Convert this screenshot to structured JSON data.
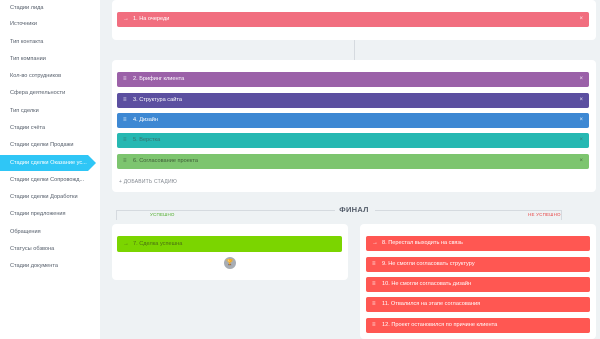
{
  "sidebar": {
    "items": [
      {
        "label": "Стадии лида"
      },
      {
        "label": "Источники"
      },
      {
        "label": "Тип контакта"
      },
      {
        "label": "Тип компании"
      },
      {
        "label": "Кол-во сотрудников"
      },
      {
        "label": "Сфера деятельности"
      },
      {
        "label": "Тип сделки"
      },
      {
        "label": "Стадии счёта"
      },
      {
        "label": "Стадии сделки Продажи"
      },
      {
        "label": "Стадии сделки Оказание ус..."
      },
      {
        "label": "Стадии сделки Сопровожд..."
      },
      {
        "label": "Стадии сделки Доработки"
      },
      {
        "label": "Стадии предложения"
      },
      {
        "label": "Обращения"
      },
      {
        "label": "Статусы обзвона"
      },
      {
        "label": "Стадии документа"
      }
    ],
    "active_index": 9
  },
  "first_stage": {
    "label": "1. На очереди",
    "color": "#f16e7f"
  },
  "process_stages": [
    {
      "label": "2. Брифинг клиента",
      "color": "#9b61a8"
    },
    {
      "label": "3. Структура сайта",
      "color": "#5b4fa0"
    },
    {
      "label": "4. Дизайн",
      "color": "#3d88d3"
    },
    {
      "label": "5. Верстка",
      "color": "#26b8b2"
    },
    {
      "label": "6. Согласование проекта",
      "color": "#7dc56f"
    }
  ],
  "add_stage_label": "+ ДОБАВИТЬ СТАДИЮ",
  "final": {
    "title": "ФИНАЛ",
    "success_caption": "УСПЕШНО",
    "fail_caption": "НЕ УСПЕШНО",
    "success_stage": {
      "label": "7. Сделка успешна",
      "color": "#7bd500"
    },
    "fail_stages": [
      {
        "label": "8. Перестал выходить на связь",
        "color": "#ff5752"
      },
      {
        "label": "9. Не смогли согласовать структуру",
        "color": "#ff5752"
      },
      {
        "label": "10. Не смогли согласовать дизайн",
        "color": "#ff5752"
      },
      {
        "label": "11. Отвалился на этапе согласования",
        "color": "#ff5752"
      },
      {
        "label": "12. Проект остановился по причине клиента",
        "color": "#ff5752"
      }
    ]
  },
  "icons": {
    "first_stage": "arrow-right-icon",
    "process_stage": "drag-handle-icon",
    "success_stage": "arrow-right-icon",
    "fail_stage": "arrow-right-icon",
    "trophy": "trophy-icon"
  }
}
